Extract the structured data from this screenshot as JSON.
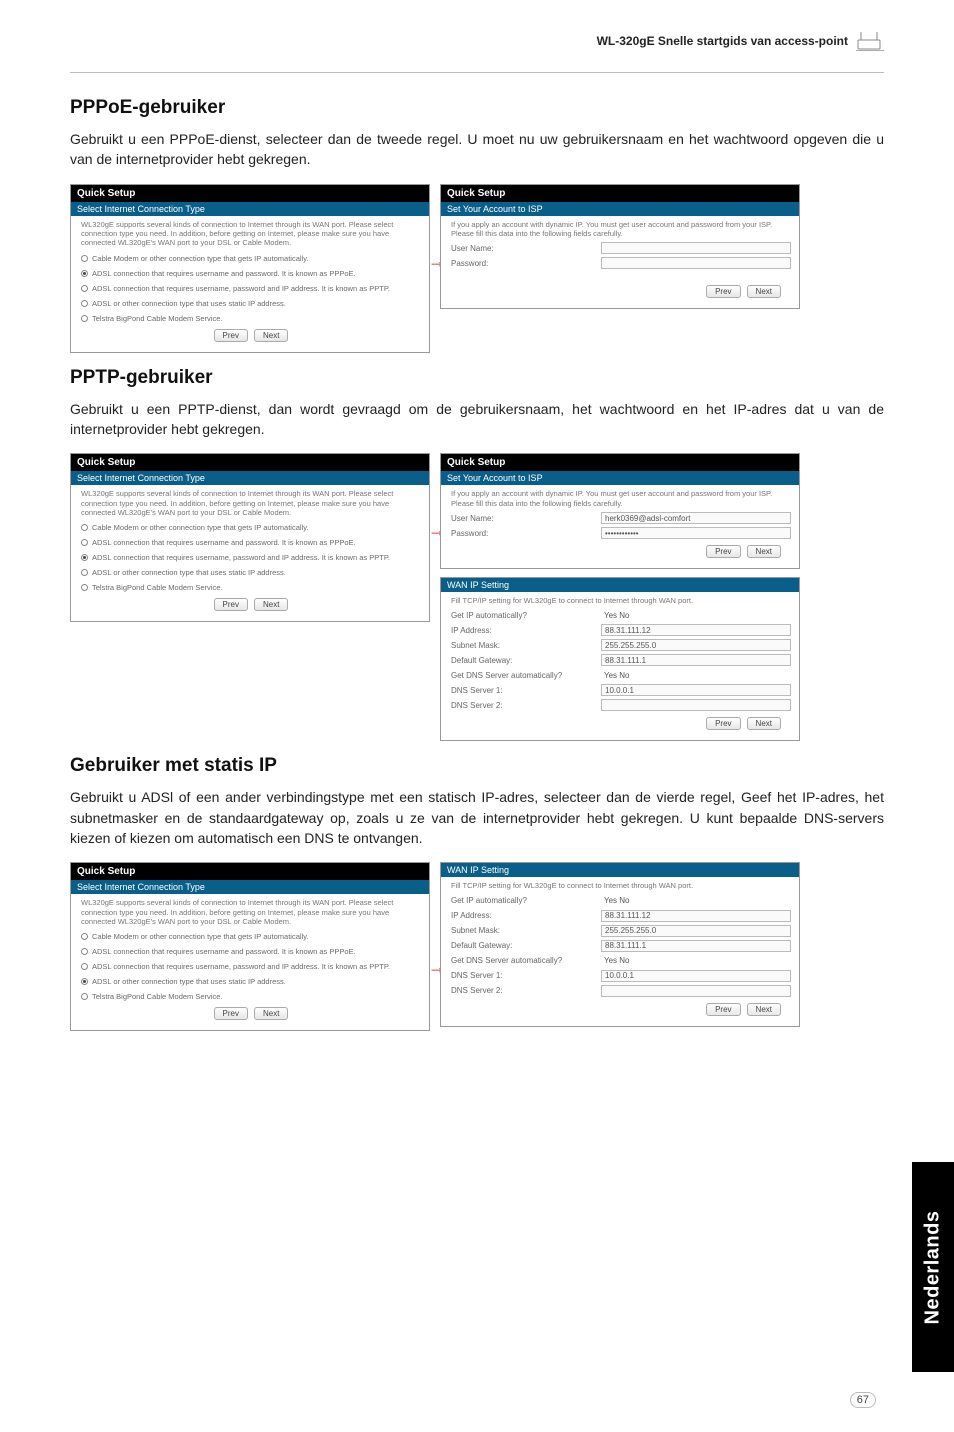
{
  "header": {
    "title": "WL-320gE Snelle startgids van access-point"
  },
  "pppoe": {
    "title": "PPPoE-gebruiker",
    "text": "Gebruikt u een PPPoE-dienst, selecteer dan de tweede regel. U moet nu uw gebruikersnaam en het wachtwoord opgeven die u van de internetprovider hebt gekregen."
  },
  "pptp": {
    "title": "PPTP-gebruiker",
    "text": "Gebruikt u een PPTP-dienst, dan wordt gevraagd om de gebruikersnaam, het wachtwoord en het IP-adres dat u van de internetprovider hebt gekregen."
  },
  "static": {
    "title": "Gebruiker met statis IP",
    "text": "Gebruikt u ADSl of een ander verbindingstype met een statisch IP-adres, selecteer dan de vierde regel, Geef het IP-adres, het subnetmasker en de standaardgateway op, zoals u ze van de internetprovider hebt gekregen. U kunt bepaalde DNS-servers kiezen of kiezen om automatisch een DNS te ontvangen."
  },
  "quick_setup": {
    "hdr": "Quick Setup",
    "sub": "Select Internet Connection Type",
    "desc": "WL320gE supports several kinds of connection to Internet through its WAN port. Please select connection type you need. In addition, before getting on Internet, please make sure you have connected WL320gE's WAN port to your DSL or Cable Modem.",
    "opts": {
      "o1": "Cable Modem or other connection type that gets IP automatically.",
      "o2": "ADSL connection that requires username and password. It is known as PPPoE.",
      "o3": "ADSL connection that requires username, password and IP address. It is known as PPTP.",
      "o4": "ADSL or other connection type that uses static IP address.",
      "o5": "Telstra BigPond Cable Modem Service."
    },
    "btn_prev": "Prev",
    "btn_next": "Next"
  },
  "isp_login": {
    "sub": "Set Your Account to ISP",
    "desc": "If you apply an account with dynamic IP. You must get user account and password from your ISP. Please fill this data into the following fields carefully.",
    "user_label": "User Name:",
    "pass_label": "Password:",
    "user_val": "herk0369@adsl-comfort",
    "pass_val": "••••••••••••"
  },
  "wan_ip": {
    "hdr": "WAN IP Setting",
    "desc": "Fill TCP/IP setting for WL320gE to connect to Internet through WAN port.",
    "rows": {
      "get_auto": "Get IP automatically?",
      "ip": "IP Address:",
      "mask": "Subnet Mask:",
      "gw": "Default Gateway:",
      "dns_auto": "Get DNS Server automatically?",
      "dns1": "DNS Server 1:",
      "dns2": "DNS Server 2:"
    },
    "vals": {
      "yn": "Yes   No",
      "ip": "88.31.111.12",
      "mask": "255.255.255.0",
      "gw": "88.31.111.1",
      "dns1": "10.0.0.1",
      "dns2": ""
    }
  },
  "side_tab": "Nederlands",
  "page_num": "67"
}
